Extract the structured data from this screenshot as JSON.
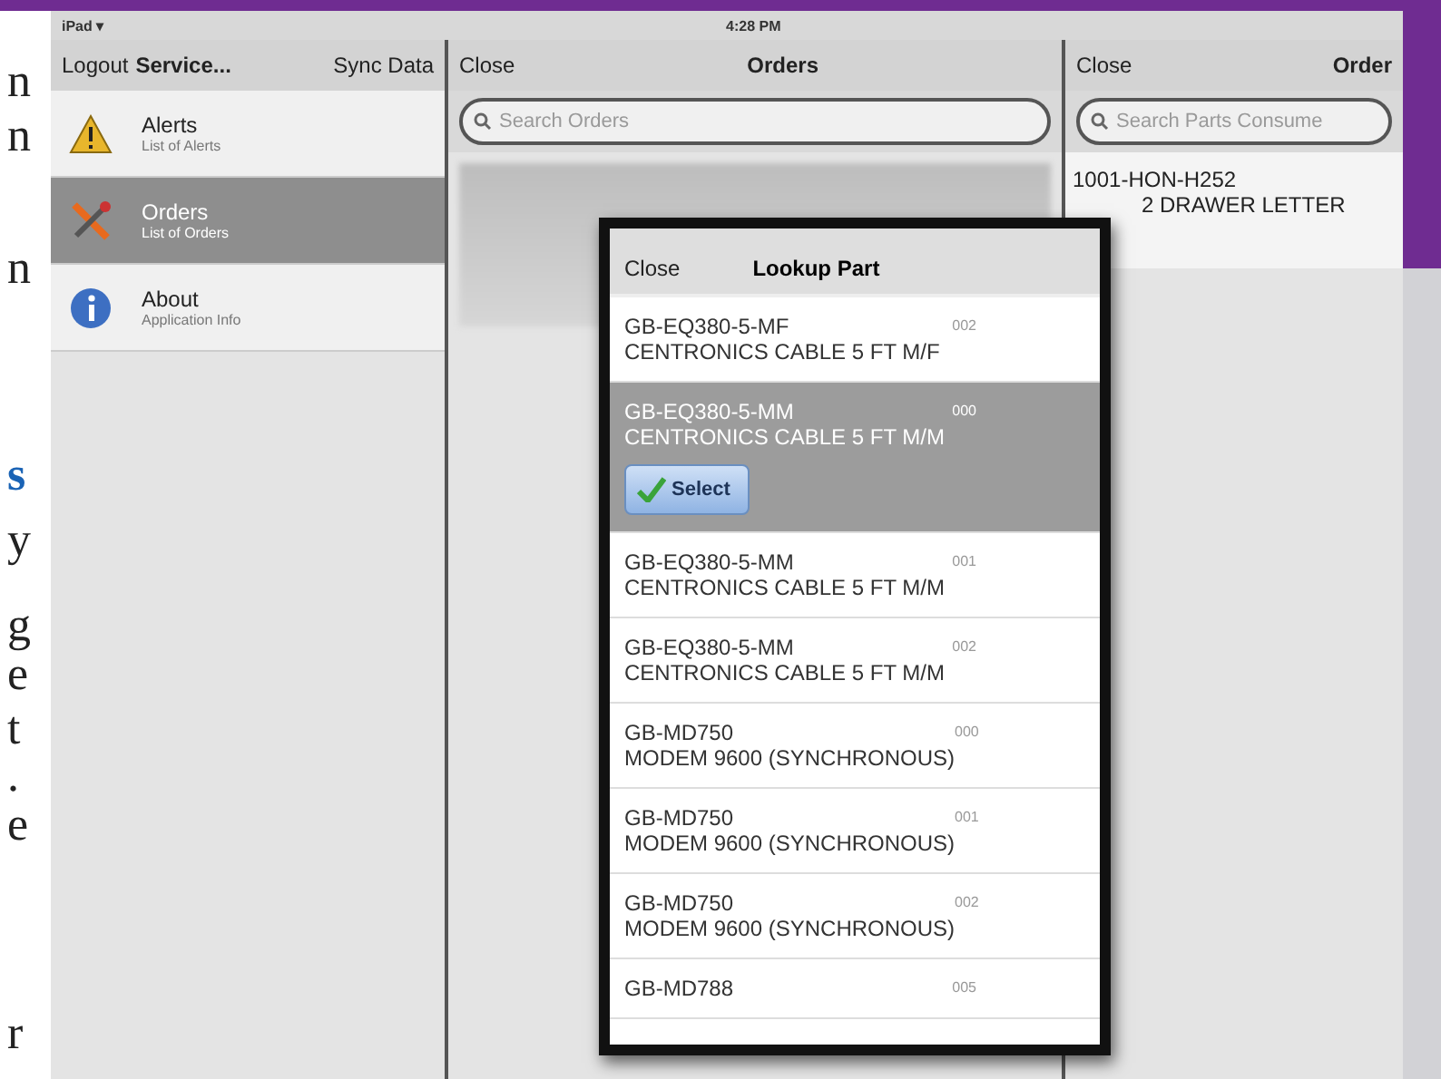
{
  "margin_text": [
    {
      "text": "n",
      "kind": "plain"
    },
    {
      "text": "n",
      "kind": "plain"
    },
    {
      "text": "n",
      "kind": "plain"
    },
    {
      "text": "s",
      "kind": "link"
    },
    {
      "text": "y",
      "kind": "plain"
    },
    {
      "text": "g",
      "kind": "plain"
    },
    {
      "text": "e",
      "kind": "plain"
    },
    {
      "text": "t",
      "kind": "plain"
    },
    {
      "text": ".",
      "kind": "plain"
    },
    {
      "text": "e",
      "kind": "plain"
    },
    {
      "text": "r",
      "kind": "plain"
    }
  ],
  "status_bar": {
    "device": "iPad ▾",
    "time": "4:28 PM"
  },
  "sidebar": {
    "nav": {
      "left": "Logout",
      "title": "Service...",
      "right": "Sync Data"
    },
    "items": [
      {
        "title": "Alerts",
        "subtitle": "List of Alerts",
        "kind": "warning",
        "selected": false
      },
      {
        "title": "Orders",
        "subtitle": "List of Orders",
        "kind": "tools",
        "selected": true
      },
      {
        "title": "About",
        "subtitle": "Application Info",
        "kind": "info",
        "selected": false
      }
    ]
  },
  "orders_panel": {
    "nav": {
      "left": "Close",
      "title": "Orders"
    },
    "search": {
      "placeholder": "Search Orders"
    }
  },
  "parts_panel": {
    "nav": {
      "left": "Close",
      "title": "Order"
    },
    "search": {
      "placeholder": "Search Parts Consume"
    },
    "items": [
      {
        "line1": "1001-HON-H252",
        "line2": "2 DRAWER LETTER"
      }
    ]
  },
  "lookup_dialog": {
    "close": "Close",
    "title": "Lookup Part",
    "select_button": "Select",
    "rows": [
      {
        "part": "GB-EQ380-5-MF",
        "description": "CENTRONICS CABLE 5 FT M/F",
        "code": "002",
        "selected": false
      },
      {
        "part": "GB-EQ380-5-MM",
        "description": "CENTRONICS CABLE 5 FT M/M",
        "code": "000",
        "selected": true
      },
      {
        "part": "GB-EQ380-5-MM",
        "description": "CENTRONICS CABLE 5 FT M/M",
        "code": "001",
        "selected": false
      },
      {
        "part": "GB-EQ380-5-MM",
        "description": "CENTRONICS CABLE 5 FT M/M",
        "code": "002",
        "selected": false
      },
      {
        "part": "GB-MD750",
        "description": "MODEM 9600 (SYNCHRONOUS)",
        "code": "000",
        "selected": false
      },
      {
        "part": "GB-MD750",
        "description": "MODEM 9600 (SYNCHRONOUS)",
        "code": "001",
        "selected": false
      },
      {
        "part": "GB-MD750",
        "description": "MODEM 9600 (SYNCHRONOUS)",
        "code": "002",
        "selected": false
      },
      {
        "part": "GB-MD788",
        "code": "005",
        "selected": false
      }
    ]
  }
}
